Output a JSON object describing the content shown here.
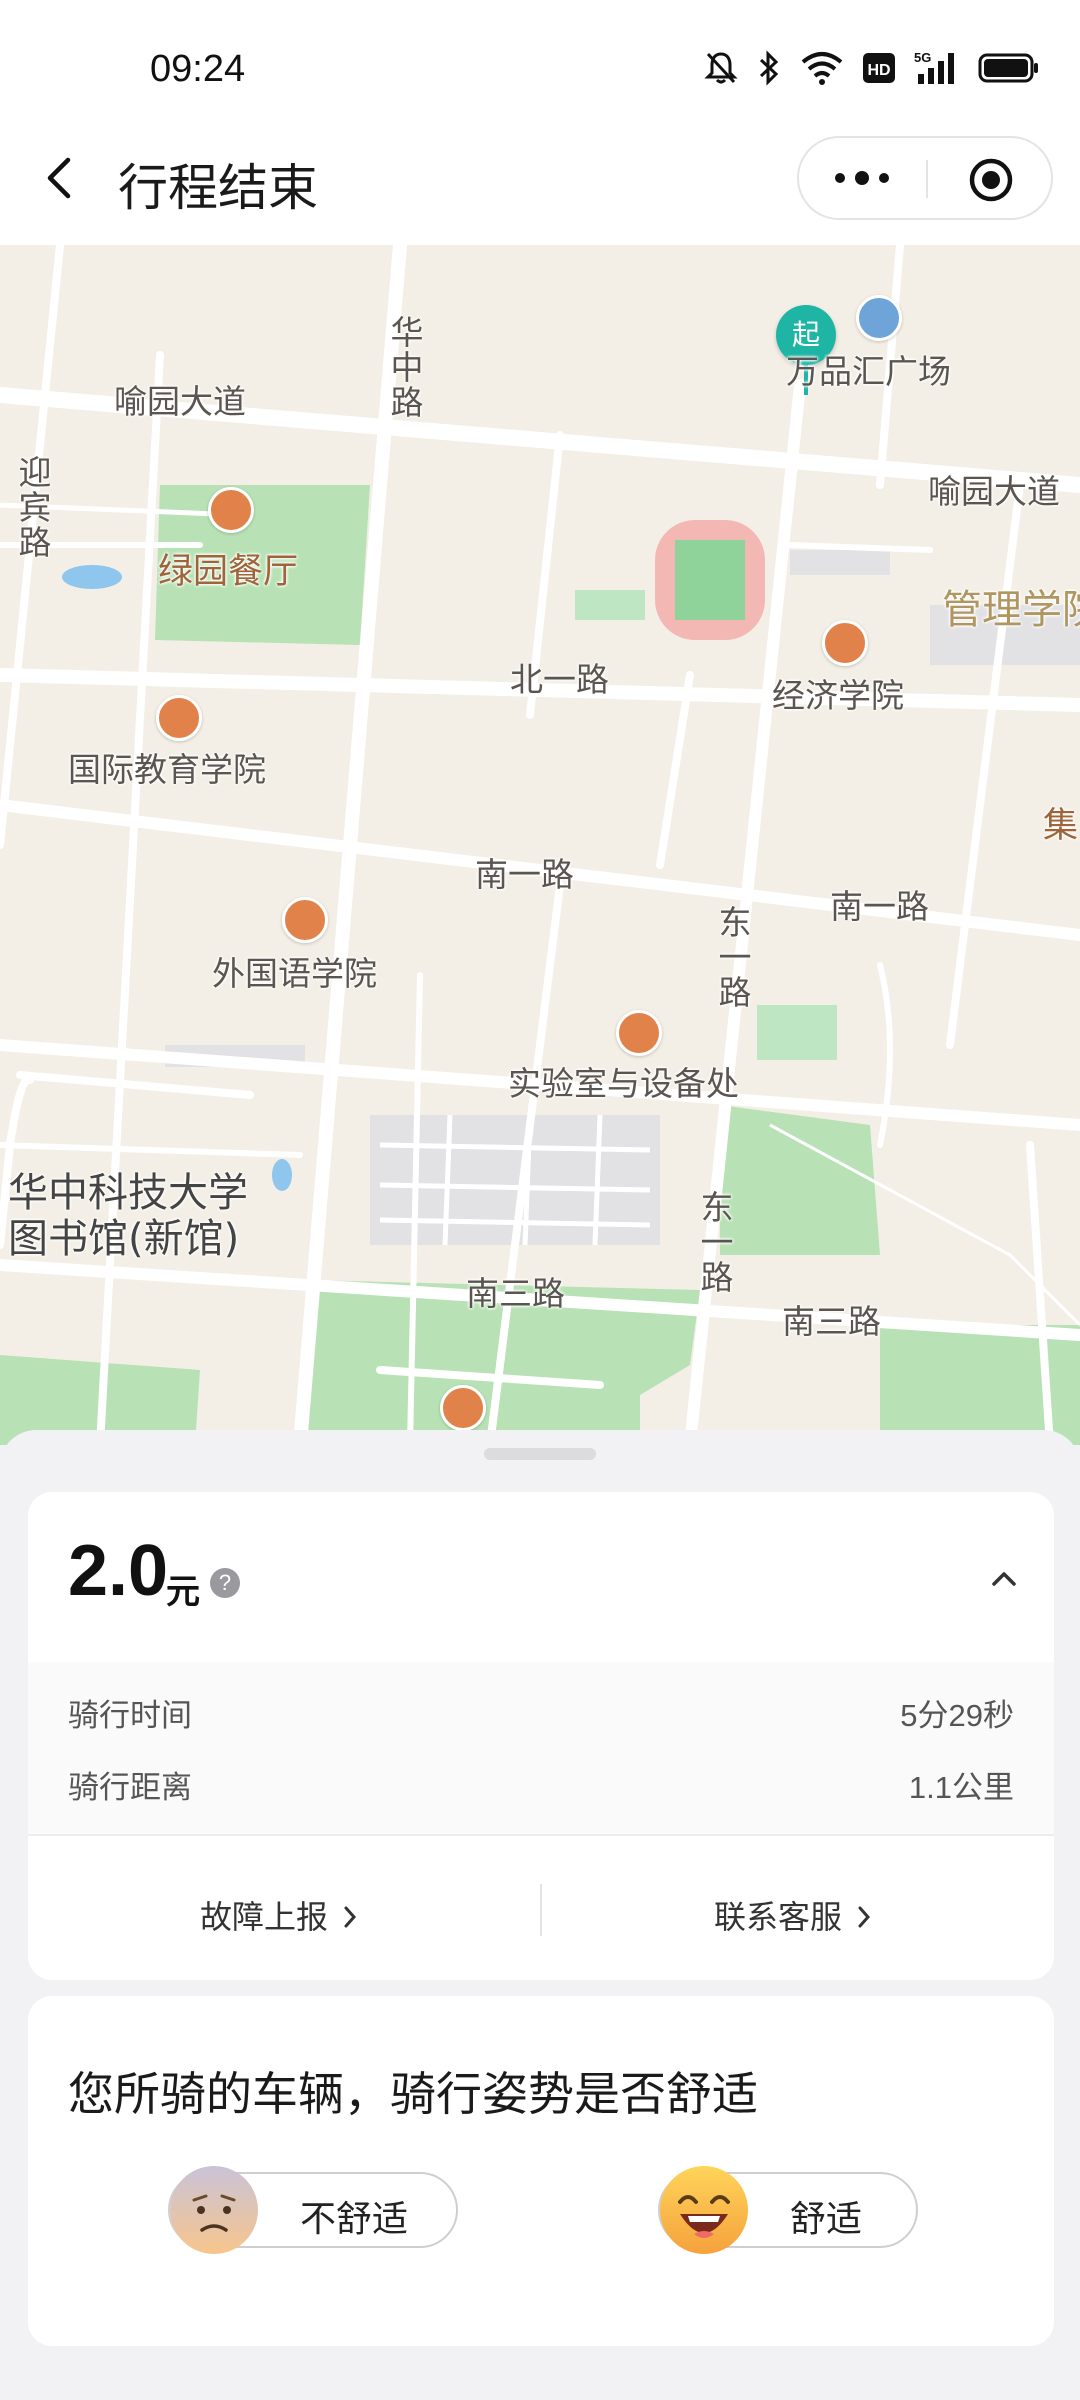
{
  "status_bar": {
    "time": "09:24",
    "icons": [
      "mute-bell-icon",
      "bluetooth-icon",
      "wifi-icon",
      "hd-icon",
      "5g-signal-icon",
      "battery-icon"
    ],
    "hd_label": "HD",
    "network_label": "5G"
  },
  "nav": {
    "title": "行程结束"
  },
  "map": {
    "start_marker": "起",
    "road_labels": {
      "yuyuan_w": "喻园大道",
      "yuyuan_e": "喻园大道",
      "huazhong": "华中路",
      "yingbin": "迎宾路",
      "beiyi": "北一路",
      "nanyi_w": "南一路",
      "nanyi_e": "南一路",
      "dongyi_n": "东一路",
      "dongyi_s": "东一路",
      "nansan_w": "南三路",
      "nansan_e": "南三路"
    },
    "poi_labels": {
      "wanpin": "万品汇广场",
      "lvyuan": "绿园餐厅",
      "jingji": "经济学院",
      "guanli": "管理学院",
      "guoji": "国际教育学院",
      "waiguoyu": "外国语学院",
      "shiyanshi": "实验室与设备处",
      "ji": "集",
      "library": "华中科技大学\n图书馆(新馆)"
    }
  },
  "fare": {
    "amount": "2.0",
    "unit": "元",
    "help": "?",
    "details": [
      {
        "label": "骑行时间",
        "value": "5分29秒"
      },
      {
        "label": "骑行距离",
        "value": "1.1公里"
      }
    ],
    "report_fault": "故障上报",
    "contact_service": "联系客服"
  },
  "survey": {
    "question": "您所骑的车辆，骑行姿势是否舒适",
    "uncomfortable": "不舒适",
    "comfortable": "舒适"
  },
  "colors": {
    "map_bg": "#f3efe6",
    "green_area": "#b8e2b5",
    "poi_orange": "#e0824a",
    "start_teal": "#1fb5a5"
  }
}
